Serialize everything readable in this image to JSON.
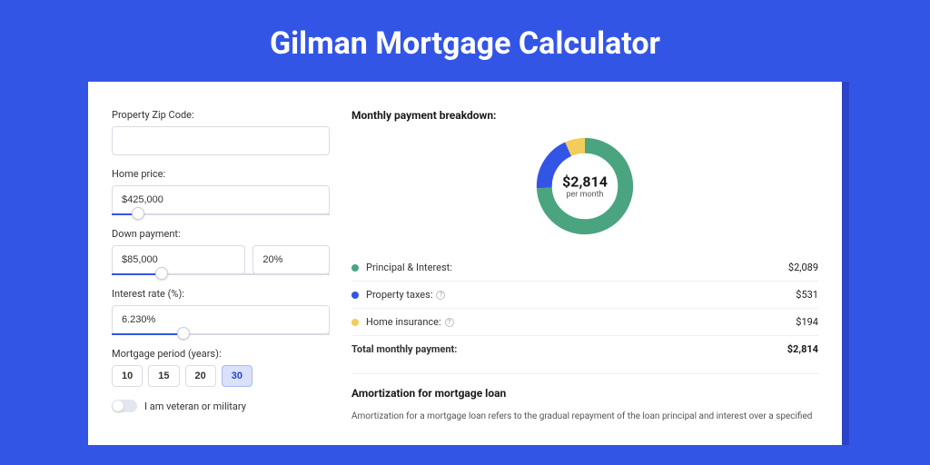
{
  "hero_title": "Gilman Mortgage Calculator",
  "form": {
    "zip": {
      "label": "Property Zip Code:",
      "value": ""
    },
    "home_price": {
      "label": "Home price:",
      "value": "$425,000",
      "slider_pct": 9
    },
    "down_payment": {
      "label": "Down payment:",
      "amount": "$85,000",
      "pct": "20%",
      "slider_pct": 20
    },
    "interest_rate": {
      "label": "Interest rate (%):",
      "value": "6.230%",
      "slider_pct": 30
    },
    "period": {
      "label": "Mortgage period (years):",
      "options": [
        "10",
        "15",
        "20",
        "30"
      ],
      "active": "30"
    },
    "veteran": {
      "label": "I am veteran or military"
    }
  },
  "breakdown": {
    "title": "Monthly payment breakdown:",
    "center_amount": "$2,814",
    "center_sub": "per month",
    "items": [
      {
        "label": "Principal & Interest:",
        "value": "$2,089",
        "color": "#4aa480",
        "info": false
      },
      {
        "label": "Property taxes:",
        "value": "$531",
        "color": "#3355e6",
        "info": true
      },
      {
        "label": "Home insurance:",
        "value": "$194",
        "color": "#f3cd5b",
        "info": true
      }
    ],
    "total_label": "Total monthly payment:",
    "total_value": "$2,814"
  },
  "chart_data": {
    "type": "pie",
    "title": "Monthly payment breakdown",
    "series": [
      {
        "name": "Principal & Interest",
        "value": 2089,
        "color": "#4aa480"
      },
      {
        "name": "Property taxes",
        "value": 531,
        "color": "#3355e6"
      },
      {
        "name": "Home insurance",
        "value": 194,
        "color": "#f3cd5b"
      }
    ],
    "total": 2814,
    "unit": "USD per month"
  },
  "amortization": {
    "title": "Amortization for mortgage loan",
    "body": "Amortization for a mortgage loan refers to the gradual repayment of the loan principal and interest over a specified"
  }
}
